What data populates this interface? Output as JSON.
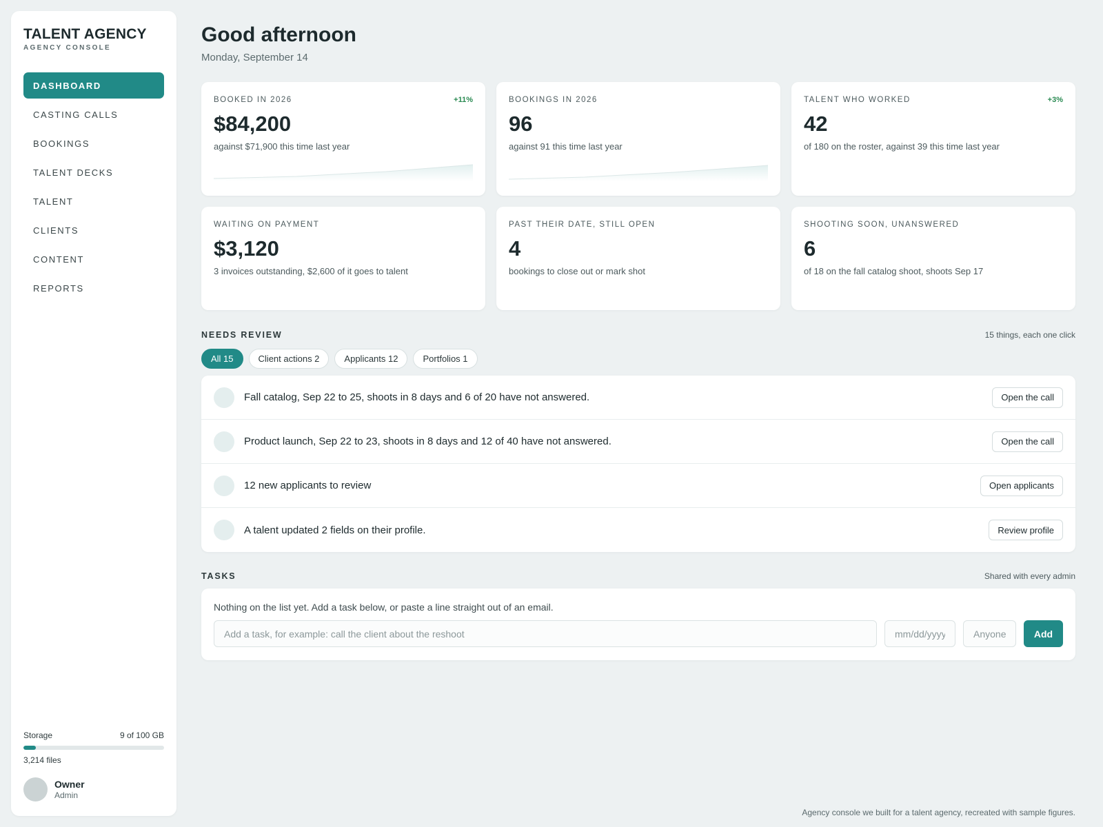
{
  "brand": {
    "title": "TALENT AGENCY",
    "subtitle": "AGENCY CONSOLE"
  },
  "nav": {
    "items": [
      {
        "label": "DASHBOARD",
        "active": true
      },
      {
        "label": "CASTING CALLS"
      },
      {
        "label": "BOOKINGS"
      },
      {
        "label": "TALENT DECKS"
      },
      {
        "label": "TALENT"
      },
      {
        "label": "CLIENTS"
      },
      {
        "label": "CONTENT"
      },
      {
        "label": "REPORTS"
      }
    ]
  },
  "storage": {
    "label": "Storage",
    "value": "9 of 100 GB",
    "used_fraction": 0.09,
    "files": "3,214 files"
  },
  "user": {
    "name": "Owner",
    "role": "Admin"
  },
  "header": {
    "greeting": "Good afternoon",
    "date": "Monday, September 14"
  },
  "kpis": [
    {
      "label": "BOOKED IN 2026",
      "delta": "+11%",
      "value": "$84,200",
      "note": "against $71,900 this time last year",
      "sparkline": true
    },
    {
      "label": "BOOKINGS IN 2026",
      "delta": "",
      "value": "96",
      "note": "against 91 this time last year",
      "sparkline": true
    },
    {
      "label": "TALENT WHO WORKED",
      "delta": "+3%",
      "value": "42",
      "note": "of 180 on the roster, against 39 this time last year",
      "sparkline": false
    },
    {
      "label": "WAITING ON PAYMENT",
      "delta": "",
      "value": "$3,120",
      "note": "3 invoices outstanding, $2,600 of it goes to talent",
      "sparkline": false
    },
    {
      "label": "PAST THEIR DATE, STILL OPEN",
      "delta": "",
      "value": "4",
      "note": "bookings to close out or mark shot",
      "sparkline": false
    },
    {
      "label": "SHOOTING SOON, UNANSWERED",
      "delta": "",
      "value": "6",
      "note": "of 18 on the fall catalog shoot, shoots Sep 17",
      "sparkline": false
    }
  ],
  "review": {
    "title": "NEEDS REVIEW",
    "aside": "15 things, each one click",
    "chips": [
      {
        "label": "All 15",
        "active": true
      },
      {
        "label": "Client actions 2"
      },
      {
        "label": "Applicants 12"
      },
      {
        "label": "Portfolios 1"
      }
    ],
    "items": [
      {
        "text": "Fall catalog, Sep 22 to 25, shoots in 8 days and 6 of 20 have not answered.",
        "action": "Open the call"
      },
      {
        "text": "Product launch, Sep 22 to 23, shoots in 8 days and 12 of 40 have not answered.",
        "action": "Open the call"
      },
      {
        "text": "12 new applicants to review",
        "action": "Open applicants"
      },
      {
        "text": "A talent updated 2 fields on their profile.",
        "action": "Review profile"
      }
    ]
  },
  "tasks": {
    "title": "TASKS",
    "aside": "Shared with every admin",
    "empty": "Nothing on the list yet. Add a task below, or paste a line straight out of an email.",
    "input_placeholder": "Add a task, for example: call the client about the reshoot",
    "date_placeholder": "mm/dd/yyyy",
    "assignee_placeholder": "Anyone",
    "add_label": "Add"
  },
  "footer": "Agency console we built for a talent agency, recreated with sample figures.",
  "colors": {
    "accent": "#218a87",
    "positive": "#2a8a52",
    "background": "#edf1f2"
  }
}
